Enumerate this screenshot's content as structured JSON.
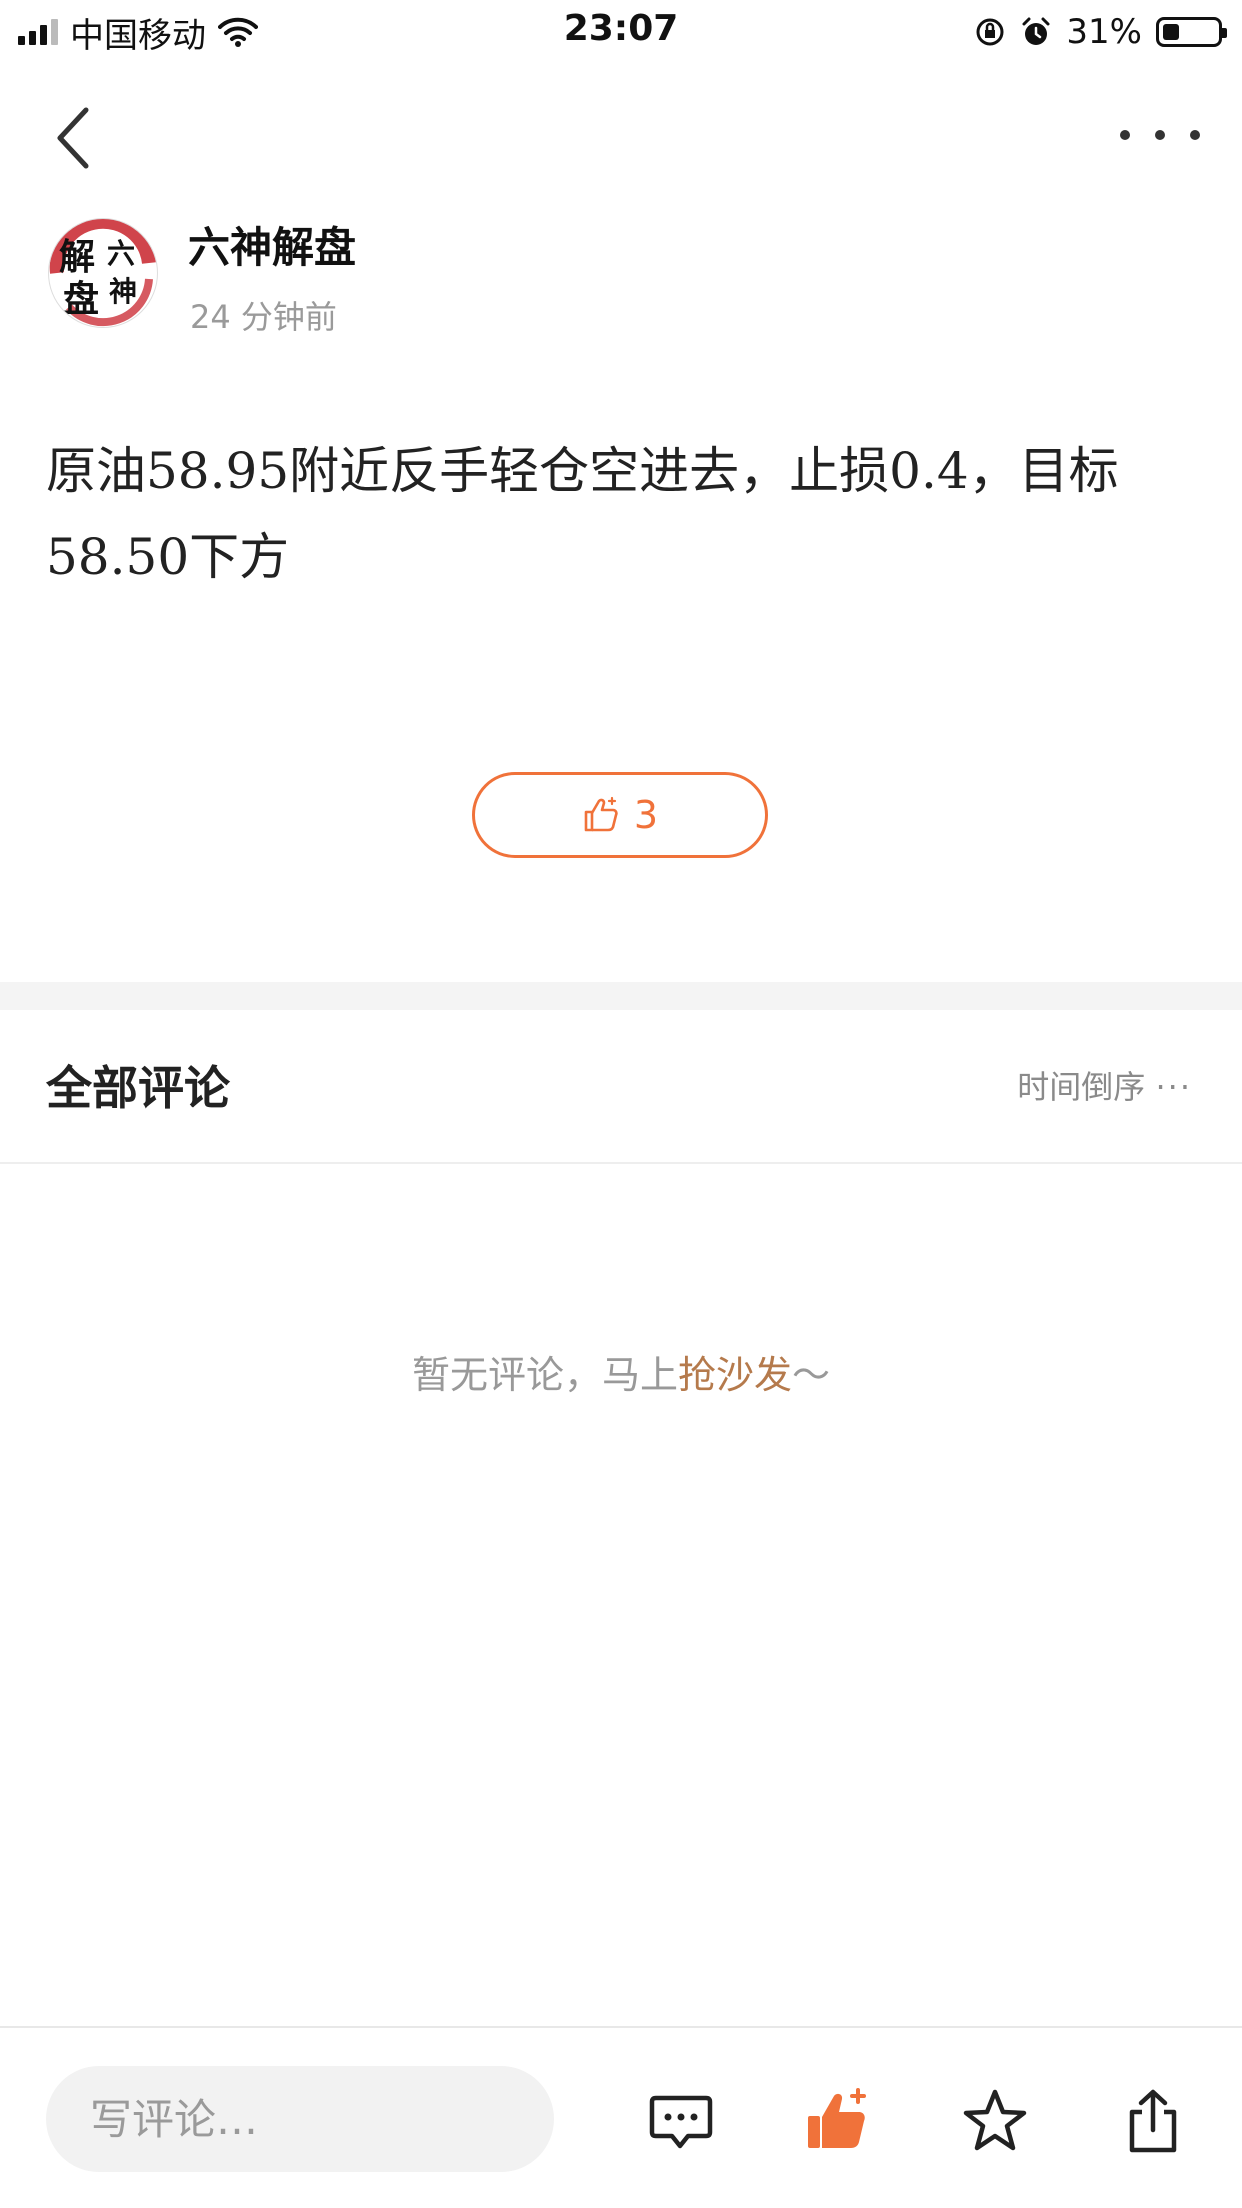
{
  "status_bar": {
    "carrier": "中国移动",
    "time": "23:07",
    "battery_percent": "31%",
    "battery_level": 0.31,
    "icons": [
      "signal-icon",
      "wifi-icon",
      "orientation-lock-icon",
      "alarm-icon",
      "battery-icon"
    ]
  },
  "nav": {
    "back_icon": "chevron-left-icon",
    "more_icon": "more-horizontal-icon"
  },
  "author": {
    "name": "六神解盘",
    "time": "24 分钟前",
    "avatar_text": [
      "解",
      "六",
      "盘",
      "神"
    ],
    "avatar_accent": "#c8232c"
  },
  "post": {
    "text": "原油58.95附近反手轻仓空进去，止损0.4，目标58.50下方"
  },
  "like": {
    "count": "3",
    "icon": "thumbs-up-icon",
    "color": "#f0723a"
  },
  "comments": {
    "title": "全部评论",
    "sort_label": "时间倒序",
    "empty_prefix": "暂无评论，马上",
    "empty_link": "抢沙发",
    "empty_suffix": "～"
  },
  "bottom_bar": {
    "input_placeholder": "写评论…",
    "icons": [
      "comment-icon",
      "thumbs-up-icon",
      "star-icon",
      "share-icon"
    ]
  }
}
